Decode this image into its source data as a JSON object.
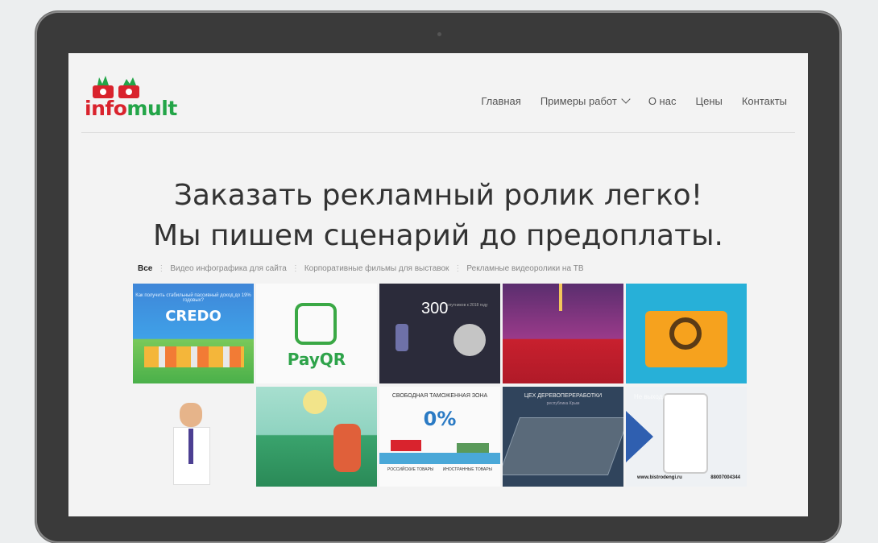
{
  "brand": {
    "logo_part1": "info",
    "logo_part2": "mult"
  },
  "nav": {
    "items": [
      "Главная",
      "Примеры работ",
      "О нас",
      "Цены",
      "Контакты"
    ]
  },
  "hero": {
    "line1": "Заказать рекламный ролик легко!",
    "line2": "Мы пишем сценарий до предоплаты."
  },
  "filters": {
    "items": [
      "Все",
      "Видео инфографика для сайта",
      "Корпоративные фильмы для выставок",
      "Рекламные видеоролики на ТВ"
    ],
    "active": "Все"
  },
  "portfolio": {
    "credo": {
      "question": "Как получить стабильный пассивный доход до 19% годовых?",
      "brand": "CREDO"
    },
    "payqr": {
      "brand": "PayQR"
    },
    "space": {
      "number": "300",
      "caption": "спутников к 2018 году"
    },
    "customs": {
      "title": "СВОБОДНАЯ ТАМОЖЕННАЯ ЗОНА",
      "percent": "0%",
      "left_label": "РОССИЙСКИЕ ТОВАРЫ",
      "right_label": "ИНОСТРАННЫЕ ТОВАРЫ"
    },
    "woodwork": {
      "title": "ЦЕХ ДЕРЕВОПЕРЕРАБОТКИ",
      "subtitle": "республика Крым"
    },
    "bistro": {
      "overlay": "Не выходя из дома",
      "site": "www.bistrodengi.ru",
      "phone": "88007004344"
    }
  },
  "colors": {
    "accent_red": "#d9232d",
    "accent_green": "#23a548",
    "screen_bg": "#f3f3f3",
    "laptop_frame": "#3a3a3a"
  }
}
